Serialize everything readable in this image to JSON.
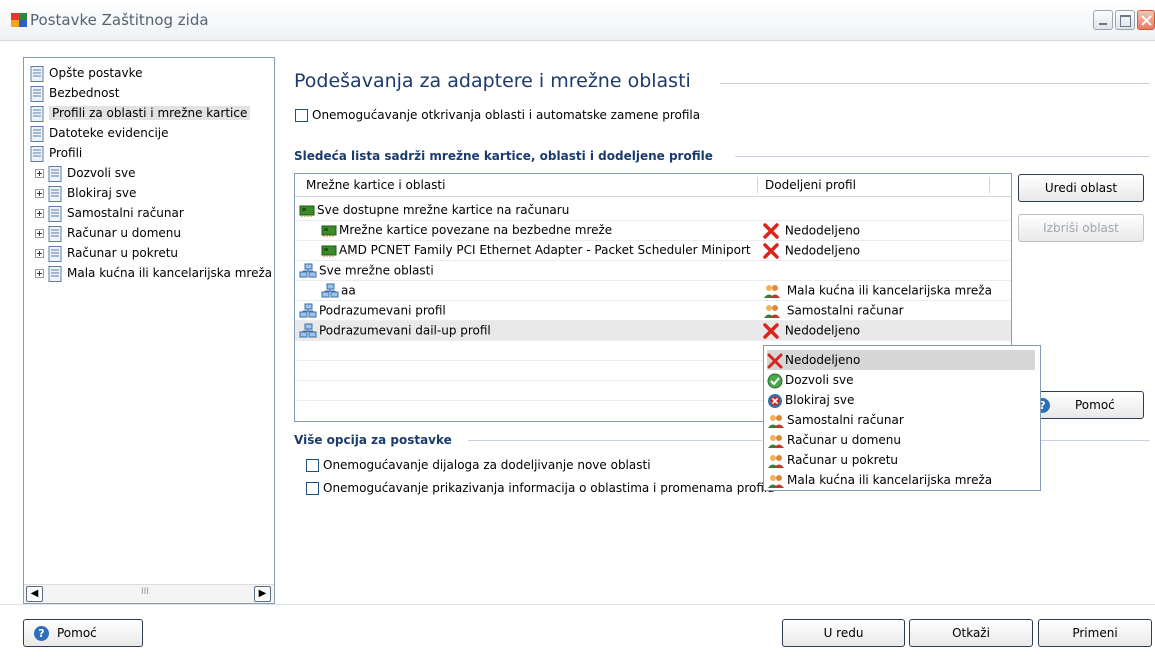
{
  "window": {
    "title": "Postavke Zaštitnog zida"
  },
  "tree": {
    "items": [
      {
        "label": "Opšte postavke"
      },
      {
        "label": "Bezbednost"
      },
      {
        "label": "Profili za oblasti i mrežne kartice"
      },
      {
        "label": "Datoteke evidencije"
      },
      {
        "label": "Profili"
      },
      {
        "label": "Dozvoli sve"
      },
      {
        "label": "Blokiraj sve"
      },
      {
        "label": "Samostalni računar"
      },
      {
        "label": "Računar u domenu"
      },
      {
        "label": "Računar u pokretu"
      },
      {
        "label": "Mala kućna ili kancelarijska mreža"
      }
    ],
    "scroll_grip": "III"
  },
  "main": {
    "title": "Podešavanja za adaptere i mrežne oblasti",
    "disable_detection": {
      "label": "Onemogućavanje otkrivanja oblasti i automatske zamene profila",
      "checked": false
    },
    "list_section_title": "Sledeća lista sadrži mrežne kartice, oblasti i dodeljene profile",
    "columns": [
      "Mrežne kartice i oblasti",
      "Dodeljeni profil"
    ],
    "rows": [
      {
        "name": "Sve dostupne mrežne kartice na računaru",
        "profile": ""
      },
      {
        "name": "Mrežne kartice povezane na bezbedne mreže",
        "profile": "Nedodeljeno"
      },
      {
        "name": "AMD PCNET Family PCI Ethernet Adapter - Packet Scheduler Miniport",
        "profile": "Nedodeljeno"
      },
      {
        "name": "Sve mrežne oblasti",
        "profile": ""
      },
      {
        "name": "aa",
        "profile": "Mala kućna ili kancelarijska mreža"
      },
      {
        "name": "Podrazumevani profil",
        "profile": "Samostalni računar"
      },
      {
        "name": "Podrazumevani dail-up profil",
        "profile": "Nedodeljeno"
      }
    ],
    "buttons": {
      "edit": "Uredi oblast",
      "delete": "Izbriši oblast",
      "help": "Pomoć"
    },
    "dropdown_options": [
      "Nedodeljeno",
      "Dozvoli sve",
      "Blokiraj sve",
      "Samostalni računar",
      "Računar u domenu",
      "Računar u pokretu",
      "Mala kućna ili kancelarijska mreža"
    ],
    "more_options": {
      "title": "Više opcija za postavke",
      "opt1": {
        "label": "Onemogućavanje dijaloga za dodeljivanje nove oblasti",
        "checked": false
      },
      "opt2": {
        "label": "Onemogućavanje prikazivanja informacija o oblastima i promenama profila",
        "checked": false
      }
    }
  },
  "footer": {
    "help": "Pomoć",
    "ok": "U redu",
    "cancel": "Otkaži",
    "apply": "Primeni"
  },
  "colors": {
    "accent": "#1b3a6d",
    "error": "#d9261c",
    "selection": "#e9e9e9"
  }
}
